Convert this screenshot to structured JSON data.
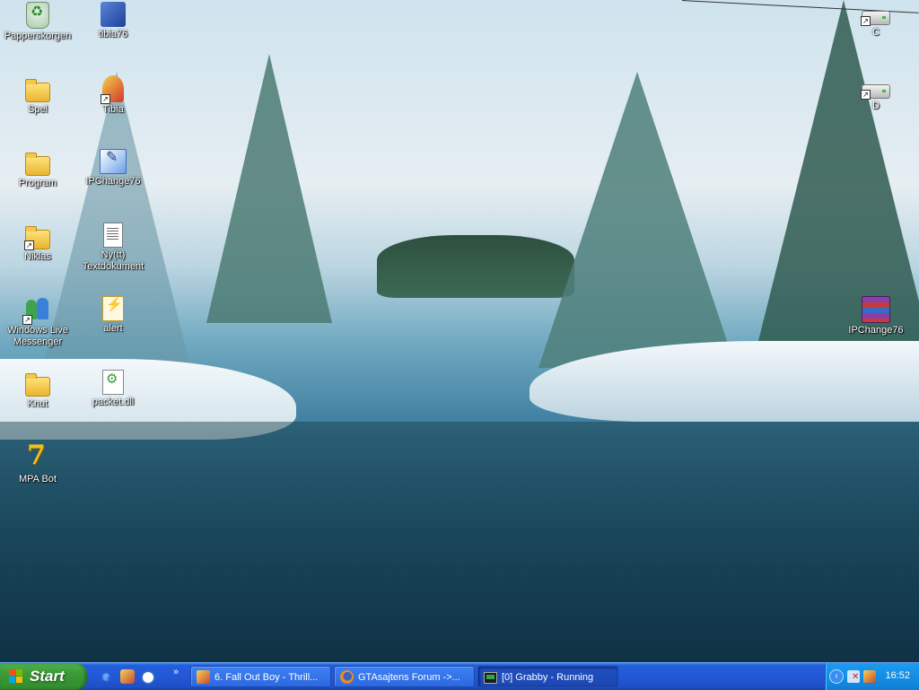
{
  "desktop": {
    "icons_left_col1": [
      {
        "label": "Papperskorgen",
        "icon": "recycle-bin-icon"
      },
      {
        "label": "Spel",
        "icon": "folder-icon"
      },
      {
        "label": "Program",
        "icon": "folder-icon"
      },
      {
        "label": "Niklas",
        "icon": "folder-icon"
      },
      {
        "label": "Windows Live Messenger",
        "icon": "messenger-icon"
      },
      {
        "label": "Knut",
        "icon": "folder-icon"
      },
      {
        "label": "MPA Bot",
        "icon": "mpa-bot-icon"
      }
    ],
    "icons_left_col2": [
      {
        "label": "tibia76",
        "icon": "network-app-icon"
      },
      {
        "label": "Tibia",
        "icon": "tibia-character-icon"
      },
      {
        "label": "IPChange76",
        "icon": "ipchanger-icon"
      },
      {
        "label": "Ny(tt) Textdokument",
        "icon": "text-document-icon"
      },
      {
        "label": "alert",
        "icon": "alert-file-icon"
      },
      {
        "label": "packet.dll",
        "icon": "dll-file-icon"
      }
    ],
    "icons_right": [
      {
        "label": "C",
        "icon": "drive-icon"
      },
      {
        "label": "D",
        "icon": "drive-icon"
      },
      {
        "label": "IPChange76",
        "icon": "winrar-archive-icon"
      }
    ]
  },
  "taskbar": {
    "start_label": "Start",
    "quick_launch": [
      "internet-explorer-icon",
      "music-player-icon",
      "browser-icon"
    ],
    "more_label": "»",
    "tasks": [
      {
        "label": "6. Fall Out Boy - Thrill...",
        "icon": "music-player-icon"
      },
      {
        "label": "GTAsajtens Forum ->...",
        "icon": "firefox-icon"
      },
      {
        "label": "[0] Grabby - Running",
        "icon": "console-icon"
      }
    ],
    "tray": {
      "toggle_label": "‹",
      "icons": [
        "network-disconnected-icon",
        "music-player-icon"
      ],
      "clock": "16:52"
    }
  },
  "colors": {
    "taskbar_blue": "#245edb",
    "start_green": "#3c9a38",
    "tray_blue": "#148ee3"
  }
}
